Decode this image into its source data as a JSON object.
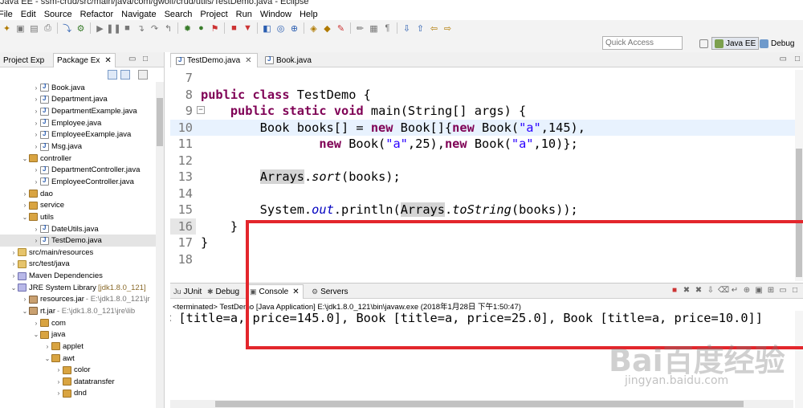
{
  "window": {
    "title": "Java EE - ssm-crud/src/main/java/com/gwolf/crud/utils/TestDemo.java - Eclipse"
  },
  "menu": [
    "File",
    "Edit",
    "Source",
    "Refactor",
    "Navigate",
    "Search",
    "Project",
    "Run",
    "Window",
    "Help"
  ],
  "quick_access": {
    "placeholder": "Quick Access"
  },
  "perspectives": [
    {
      "label": "Java EE",
      "active": true,
      "icon": "java-ee-perspective-icon"
    },
    {
      "label": "Debug",
      "active": false,
      "icon": "debug-perspective-icon"
    }
  ],
  "left_panel": {
    "tabs": [
      {
        "label": "Project Exp",
        "active": false
      },
      {
        "label": "Package Ex",
        "active": true
      }
    ],
    "tree": [
      {
        "label": "Book.java",
        "indent": 3,
        "icon": "java-file-icon",
        "twisty": "closed"
      },
      {
        "label": "Department.java",
        "indent": 3,
        "icon": "java-file-icon",
        "twisty": "closed"
      },
      {
        "label": "DepartmentExample.java",
        "indent": 3,
        "icon": "java-file-icon",
        "twisty": "closed"
      },
      {
        "label": "Employee.java",
        "indent": 3,
        "icon": "java-file-icon",
        "twisty": "closed"
      },
      {
        "label": "EmployeeExample.java",
        "indent": 3,
        "icon": "java-file-icon",
        "twisty": "closed"
      },
      {
        "label": "Msg.java",
        "indent": 3,
        "icon": "java-file-icon",
        "twisty": "closed"
      },
      {
        "label": "controller",
        "indent": 2,
        "icon": "package-icon",
        "twisty": "open"
      },
      {
        "label": "DepartmentController.java",
        "indent": 3,
        "icon": "java-file-icon",
        "twisty": "closed"
      },
      {
        "label": "EmployeeController.java",
        "indent": 3,
        "icon": "java-file-icon",
        "twisty": "closed"
      },
      {
        "label": "dao",
        "indent": 2,
        "icon": "package-icon",
        "twisty": "closed"
      },
      {
        "label": "service",
        "indent": 2,
        "icon": "package-icon",
        "twisty": "closed"
      },
      {
        "label": "utils",
        "indent": 2,
        "icon": "package-icon",
        "twisty": "open"
      },
      {
        "label": "DateUtils.java",
        "indent": 3,
        "icon": "java-file-icon",
        "twisty": "closed"
      },
      {
        "label": "TestDemo.java",
        "indent": 3,
        "icon": "java-file-icon",
        "twisty": "closed",
        "selected": true
      },
      {
        "label": "src/main/resources",
        "indent": 1,
        "icon": "source-folder-icon",
        "twisty": "closed"
      },
      {
        "label": "src/test/java",
        "indent": 1,
        "icon": "source-folder-icon",
        "twisty": "closed"
      },
      {
        "label": "Maven Dependencies",
        "indent": 1,
        "icon": "library-icon",
        "twisty": "closed"
      },
      {
        "label": "JRE System Library",
        "suffix": "[jdk1.8.0_121]",
        "indent": 1,
        "icon": "library-icon",
        "twisty": "open"
      },
      {
        "label": "resources.jar",
        "suffix2": "- E:\\jdk1.8.0_121\\jr",
        "indent": 2,
        "icon": "jar-icon",
        "twisty": "closed"
      },
      {
        "label": "rt.jar",
        "suffix2": "- E:\\jdk1.8.0_121\\jre\\lib",
        "indent": 2,
        "icon": "jar-icon",
        "twisty": "open"
      },
      {
        "label": "com",
        "indent": 3,
        "icon": "package-icon",
        "twisty": "closed"
      },
      {
        "label": "java",
        "indent": 3,
        "icon": "package-icon",
        "twisty": "open"
      },
      {
        "label": "applet",
        "indent": 4,
        "icon": "package-icon",
        "twisty": "closed"
      },
      {
        "label": "awt",
        "indent": 4,
        "icon": "package-icon",
        "twisty": "open"
      },
      {
        "label": "color",
        "indent": 5,
        "icon": "package-icon",
        "twisty": "closed"
      },
      {
        "label": "datatransfer",
        "indent": 5,
        "icon": "package-icon",
        "twisty": "closed"
      },
      {
        "label": "dnd",
        "indent": 5,
        "icon": "package-icon",
        "twisty": "closed"
      }
    ]
  },
  "editor": {
    "tabs": [
      {
        "label": "TestDemo.java",
        "active": true
      },
      {
        "label": "Book.java",
        "active": false
      }
    ],
    "lines": [
      {
        "n": "7",
        "code": ""
      },
      {
        "n": "8",
        "code": "public class TestDemo {"
      },
      {
        "n": "9",
        "code": "    public static void main(String[] args) {"
      },
      {
        "n": "10",
        "code": "        Book books[] = new Book[]{new Book(\"a\",145),"
      },
      {
        "n": "11",
        "code": "                new Book(\"a\",25),new Book(\"a\",10)};"
      },
      {
        "n": "12",
        "code": ""
      },
      {
        "n": "13",
        "code": "        Arrays.sort(books);"
      },
      {
        "n": "14",
        "code": ""
      },
      {
        "n": "15",
        "code": "        System.out.println(Arrays.toString(books));"
      },
      {
        "n": "16",
        "code": "    }"
      },
      {
        "n": "17",
        "code": "}"
      },
      {
        "n": "18",
        "code": ""
      }
    ]
  },
  "console": {
    "tabs": [
      {
        "label": "JUnit",
        "active": false,
        "icon": "junit-icon"
      },
      {
        "label": "Debug",
        "active": false,
        "icon": "debug-icon"
      },
      {
        "label": "Console",
        "active": true,
        "icon": "console-icon"
      },
      {
        "label": "Servers",
        "active": false,
        "icon": "servers-icon"
      }
    ],
    "terminated": "<terminated> TestDemo [Java Application] E:\\jdk1.8.0_121\\bin\\javaw.exe (2018年1月28日 下午1:50:47)",
    "output": "< [title=a, price=145.0], Book [title=a, price=25.0], Book [title=a, price=10.0]]"
  },
  "watermark": {
    "logo": "Bai百度经验",
    "url": "jingyan.baidu.com"
  },
  "colors": {
    "annotation": "#e3262c",
    "keyword": "#7f0055",
    "string": "#2a00ff",
    "field": "#0000c0"
  }
}
